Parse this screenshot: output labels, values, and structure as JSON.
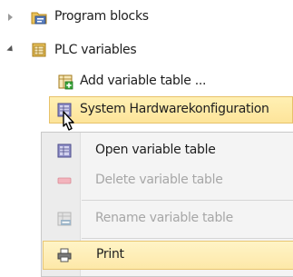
{
  "tree": {
    "items": [
      {
        "label": "Program blocks"
      },
      {
        "label": "PLC variables"
      },
      {
        "label": "Add variable table ..."
      },
      {
        "label": "System Hardwarekonfiguration"
      }
    ]
  },
  "context_menu": {
    "items": [
      {
        "label": "Open variable table",
        "enabled": true
      },
      {
        "label": "Delete variable table",
        "enabled": false
      },
      {
        "label": "Rename variable table",
        "enabled": false
      },
      {
        "label": "Print",
        "enabled": true
      }
    ]
  },
  "colors": {
    "selection": "#fde49a",
    "selection_border": "#e7c26a",
    "menu_background": "#f4f4f4",
    "disabled_text": "#a7a7a7"
  }
}
